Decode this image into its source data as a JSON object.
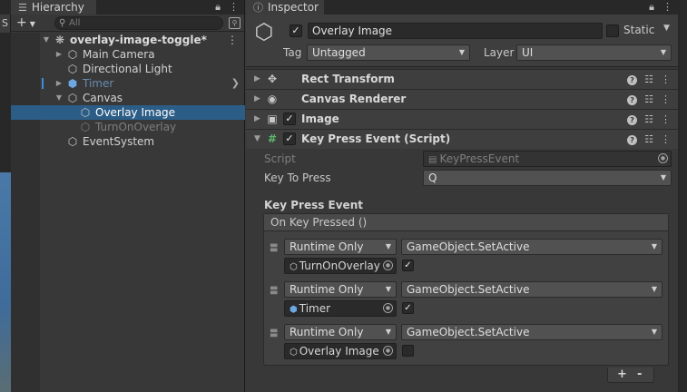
{
  "scene_tab": {
    "label": "S"
  },
  "hierarchy": {
    "tab_label": "Hierarchy",
    "search": {
      "placeholder": "All",
      "value": ""
    },
    "add_label": "+",
    "tree": [
      {
        "label": "overlay-image-toggle*",
        "kind": "scene",
        "depth": 0
      },
      {
        "label": "Main Camera",
        "depth": 1
      },
      {
        "label": "Directional Light",
        "depth": 1
      },
      {
        "label": "Timer",
        "depth": 1,
        "kind": "prefab-disabled"
      },
      {
        "label": "Canvas",
        "depth": 1
      },
      {
        "label": "Overlay Image",
        "depth": 2,
        "selected": true
      },
      {
        "label": "TurnOnOverlay",
        "depth": 2,
        "kind": "disabled"
      },
      {
        "label": "EventSystem",
        "depth": 1
      }
    ]
  },
  "inspector": {
    "tab_label": "Inspector",
    "object": {
      "active": true,
      "name": "Overlay Image",
      "static_label": "Static",
      "tag_label": "Tag",
      "tag_value": "Untagged",
      "layer_label": "Layer",
      "layer_value": "UI"
    },
    "components": [
      {
        "title": "Rect Transform",
        "icon": "rect-transform-icon",
        "has_checkbox": false
      },
      {
        "title": "Canvas Renderer",
        "icon": "canvas-renderer-icon",
        "has_checkbox": false
      },
      {
        "title": "Image",
        "icon": "image-icon",
        "has_checkbox": true
      },
      {
        "title": "Key Press Event (Script)",
        "icon": "script-icon",
        "has_checkbox": true,
        "expanded": true
      }
    ],
    "script": {
      "script_label": "Script",
      "script_value": "KeyPressEvent",
      "key_label": "Key To Press",
      "key_value": "Q",
      "event_title": "Key Press Event",
      "event_header": "On Key Pressed ()",
      "entries": [
        {
          "mode": "Runtime Only",
          "function": "GameObject.SetActive",
          "target": "TurnOnOverlay",
          "arg_checked": true
        },
        {
          "mode": "Runtime Only",
          "function": "GameObject.SetActive",
          "target": "Timer",
          "arg_checked": true
        },
        {
          "mode": "Runtime Only",
          "function": "GameObject.SetActive",
          "target": "Overlay Image",
          "arg_checked": false
        }
      ],
      "add_label": "+",
      "remove_label": "-"
    }
  }
}
